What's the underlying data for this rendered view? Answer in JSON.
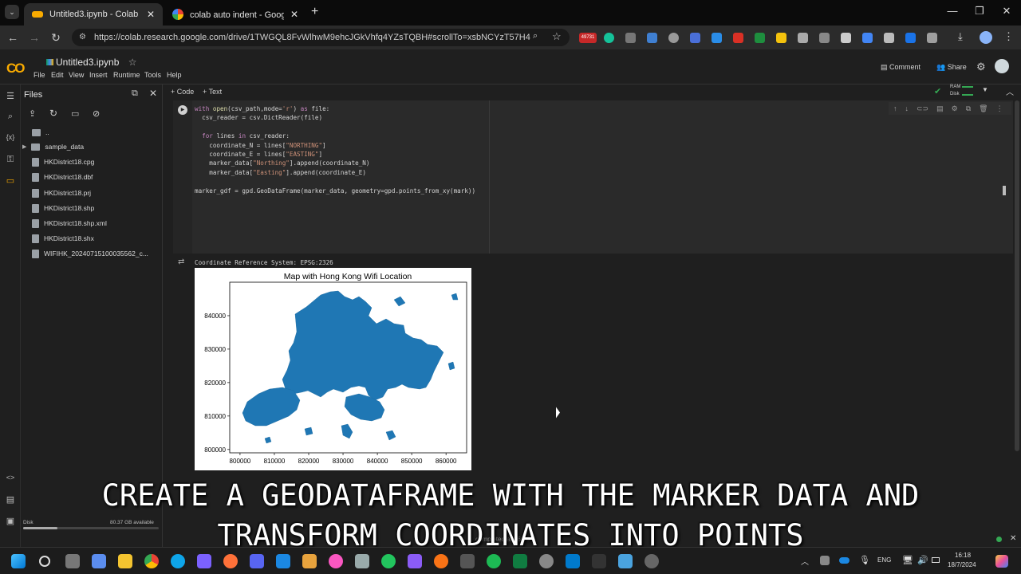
{
  "browser": {
    "tabs": [
      {
        "title": "Untitled3.ipynb - Colab",
        "active": true
      },
      {
        "title": "colab auto indent - Google 搜尋",
        "active": false
      }
    ],
    "url": "https://colab.research.google.com/drive/1TWGQL8FvWlhwM9ehcJGkVhfq4YZsTQBH#scrollTo=xsbNCYzT57H4",
    "badge": "49731"
  },
  "colab": {
    "notebook_title": "Untitled3.ipynb",
    "menus": [
      "File",
      "Edit",
      "View",
      "Insert",
      "Runtime",
      "Tools",
      "Help"
    ],
    "comment_label": "Comment",
    "share_label": "Share",
    "add_code_label": "+ Code",
    "add_text_label": "+ Text",
    "ram_label": "RAM",
    "disk_label": "Disk"
  },
  "sidebar": {
    "title": "Files",
    "items": [
      {
        "name": "..",
        "type": "folder"
      },
      {
        "name": "sample_data",
        "type": "folder"
      },
      {
        "name": "HKDistrict18.cpg",
        "type": "file"
      },
      {
        "name": "HKDistrict18.dbf",
        "type": "file"
      },
      {
        "name": "HKDistrict18.prj",
        "type": "file"
      },
      {
        "name": "HKDistrict18.shp",
        "type": "file"
      },
      {
        "name": "HKDistrict18.shp.xml",
        "type": "file"
      },
      {
        "name": "HKDistrict18.shx",
        "type": "file"
      },
      {
        "name": "WIFIHK_20240715100035562_c...",
        "type": "file"
      }
    ],
    "disk_label": "Disk",
    "disk_available": "80.37 GB available"
  },
  "code_lines": [
    "with open(csv_path,mode='r') as file:",
    "  csv_reader = csv.DictReader(file)",
    "",
    "  for lines in csv_reader:",
    "    coordinate_N = lines[\"NORTHING\"]",
    "    coordinate_E = lines[\"EASTING\"]",
    "    marker_data[\"Northing\"].append(coordinate_N)",
    "    marker_data[\"Easting\"].append(coordinate_E)",
    "",
    "marker_gdf = gpd.GeoDataFrame(marker_data, geometry=gpd.points_from_xy(mark))"
  ],
  "output_text": "Coordinate Reference System:  EPSG:2326",
  "chart_data": {
    "type": "map",
    "title": "Map with Hong Kong Wifi Location",
    "xticks": [
      "800000",
      "810000",
      "820000",
      "830000",
      "840000",
      "850000",
      "860000"
    ],
    "yticks": [
      "840000",
      "830000",
      "820000",
      "810000",
      "800000"
    ],
    "xlim": [
      797000,
      866000
    ],
    "ylim": [
      799000,
      850000
    ],
    "fill_color": "#1f77b4"
  },
  "caption": {
    "line1": "CREATE A GEODATAFRAME WITH THE MARKER DATA AND",
    "line2": "TRANSFORM COORDINATES INTO POINTS"
  },
  "taskbar": {
    "lang": "ENG",
    "time": "16:18",
    "date": "18/7/2024"
  },
  "status_text": "completed at 16:18"
}
